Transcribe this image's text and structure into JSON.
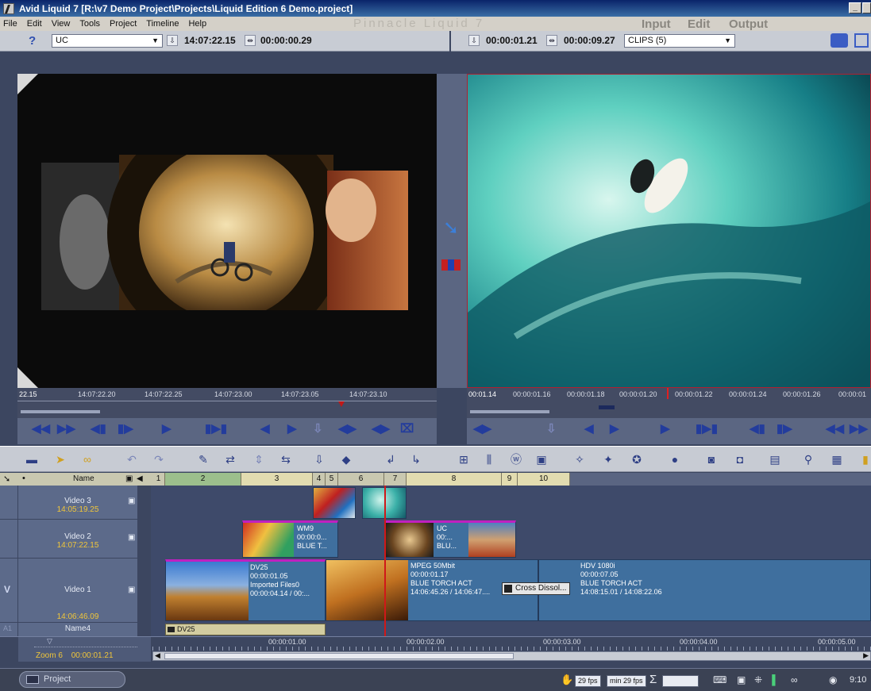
{
  "window": {
    "title": "Avid Liquid 7 [R:\\v7 Demo Project\\Projects\\Liquid Edition 6 Demo.project]",
    "minimize": "_"
  },
  "menu": [
    "File",
    "Edit",
    "View",
    "Tools",
    "Project",
    "Timeline",
    "Help"
  ],
  "brand": "Pinnacle Liquid 7",
  "modes": {
    "input": "Input",
    "edit": "Edit",
    "output": "Output"
  },
  "source": {
    "help_icon": "?",
    "clip_select": "UC",
    "tc_in": "14:07:22.15",
    "duration": "00:00:00.29",
    "scrub_labels": [
      "22.15",
      "14:07:22.20",
      "14:07:22.25",
      "14:07:23.00",
      "14:07:23.05",
      "14:07:23.10"
    ]
  },
  "record": {
    "tc_in": "00:00:01.21",
    "duration": "00:00:09.27",
    "bin_select": "CLIPS (5)",
    "scrub_labels": [
      "00:01.14",
      "00:00:01.16",
      "00:00:01.18",
      "00:00:01.20",
      "00:00:01.22",
      "00:00:01.24",
      "00:00:01.26",
      "00:00:01"
    ]
  },
  "timeline": {
    "header": {
      "name_col": "Name"
    },
    "ruler_segments": [
      "1",
      "2",
      "3",
      "4",
      "5",
      "6",
      "7",
      "8",
      "9",
      "10"
    ],
    "tracks": [
      {
        "label": "Video 3",
        "tc": "14:05:19.25"
      },
      {
        "label": "Video 2",
        "tc": "14:07:22.15"
      },
      {
        "label": "Video 1",
        "tc": "14:06:46.09",
        "letter": "V"
      },
      {
        "label": "Name4",
        "letter": "A1"
      }
    ],
    "clips": {
      "v2a": [
        "WM9",
        "00:00:0...",
        "BLUE T..."
      ],
      "v2b": [
        "UC",
        "00:...",
        "BLU..."
      ],
      "v1a": [
        "DV25",
        "00:00:01.05",
        "Imported Files0",
        "00:00:04.14 / 00:..."
      ],
      "v1b": [
        "MPEG 50Mbit",
        "00:00:01.17",
        "BLUE TORCH ACT",
        "14:06:45.26 / 14:06:47...."
      ],
      "v1c": [
        "HDV 1080i",
        "00:00:07.05",
        "BLUE TORCH ACT",
        "14:08:15.01 / 14:08:22.06"
      ],
      "transition": "Cross Dissol...",
      "audio": "DV25"
    },
    "time_labels": [
      "00:00:01.00",
      "00:00:02.00",
      "00:00:03.00",
      "00:00:04.00",
      "00:00:05.00"
    ],
    "zoom": {
      "label": "Zoom",
      "value": "6",
      "tc": "00:00:01.21"
    }
  },
  "taskbar": {
    "project_button": "Project",
    "fps": "29 fps",
    "min_fps": "min 29 fps",
    "sigma": "Σ",
    "clock": "9:10"
  }
}
